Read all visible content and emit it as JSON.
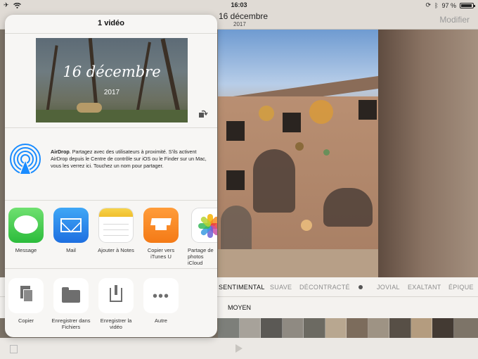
{
  "status_bar": {
    "time": "16:03",
    "battery": "97 %"
  },
  "navbar": {
    "title": "16 décembre",
    "subtitle": "2017",
    "edit_label": "Modifier"
  },
  "moods": {
    "items": [
      "SENTIMENTAL",
      "SUAVE",
      "DÉCONTRACTÉ",
      "JOVIAL",
      "EXALTANT",
      "ÉPIQUE"
    ],
    "selected": "SENTIMENTAL",
    "length": "MOYEN"
  },
  "share_sheet": {
    "title": "1 vidéo",
    "preview": {
      "title": "16 décembre",
      "year": "2017"
    },
    "airdrop": {
      "name": "AirDrop",
      "description": ". Partagez avec des utilisateurs à proximité. S'ils activent AirDrop depuis le Centre de contrôle sur iOS ou le Finder sur un Mac, vous les verrez ici. Touchez un nom pour partager."
    },
    "apps": [
      {
        "label": "Message",
        "icon": "messages-icon"
      },
      {
        "label": "Mail",
        "icon": "mail-icon"
      },
      {
        "label": "Ajouter à Notes",
        "icon": "notes-icon"
      },
      {
        "label": "Copier vers iTunes U",
        "icon": "itunes-u-icon"
      },
      {
        "label": "Partage de photos iCloud",
        "icon": "photos-icon"
      }
    ],
    "actions": [
      {
        "label": "Copier",
        "icon": "copy-icon"
      },
      {
        "label": "Enregistrer dans Fichiers",
        "icon": "folder-icon"
      },
      {
        "label": "Enregistrer la vidéo",
        "icon": "save-video-icon"
      },
      {
        "label": "Autre",
        "icon": "more-icon"
      }
    ]
  },
  "colors": {
    "accent": "#1a8cff",
    "active_mood": "#111111",
    "inactive_mood": "#8d8d8d"
  }
}
